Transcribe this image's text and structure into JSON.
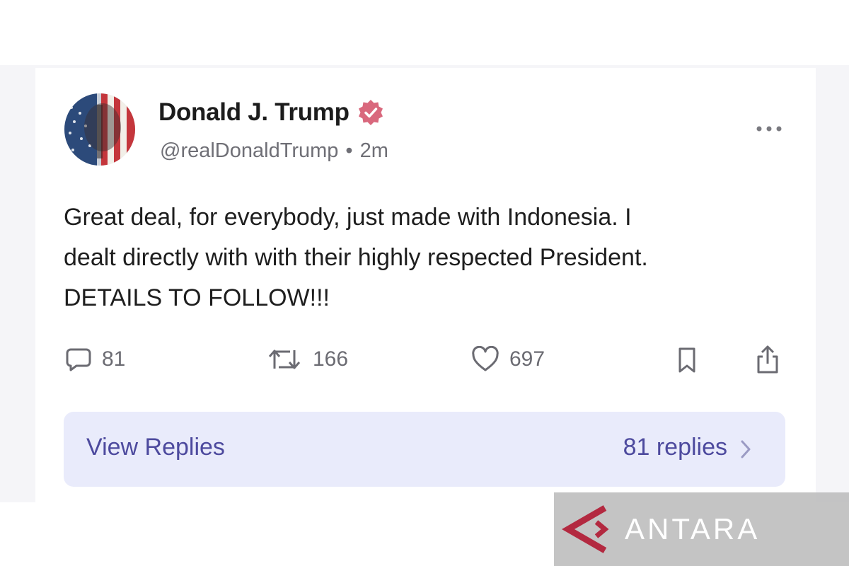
{
  "post": {
    "display_name": "Donald J. Trump",
    "handle": "@realDonaldTrump",
    "separator": "•",
    "time": "2m",
    "text_lines": [
      "Great deal, for everybody, just made with Indonesia. I",
      "dealt directly with with their highly respected President.",
      "DETAILS TO FOLLOW!!!"
    ],
    "icons": {
      "avatar": "profile-avatar",
      "verified": "verified-badge-icon",
      "more": "more-options-icon"
    }
  },
  "actions": {
    "replies": {
      "count": "81",
      "icon": "comment-icon"
    },
    "reposts": {
      "count": "166",
      "icon": "repost-icon"
    },
    "likes": {
      "count": "697",
      "icon": "heart-icon"
    },
    "bookmark": {
      "icon": "bookmark-icon"
    },
    "share": {
      "icon": "share-icon"
    }
  },
  "replies_bar": {
    "label": "View Replies",
    "count_text": "81 replies",
    "icon": "chevron-right-icon"
  },
  "watermark": {
    "text": "ANTARA"
  },
  "colors": {
    "verified_badge": "#d9687d",
    "replies_bar_bg": "#e9ebfb",
    "replies_bar_text": "#4d4a9e",
    "muted_text": "#6f6f76",
    "watermark_red": "#b32940"
  }
}
